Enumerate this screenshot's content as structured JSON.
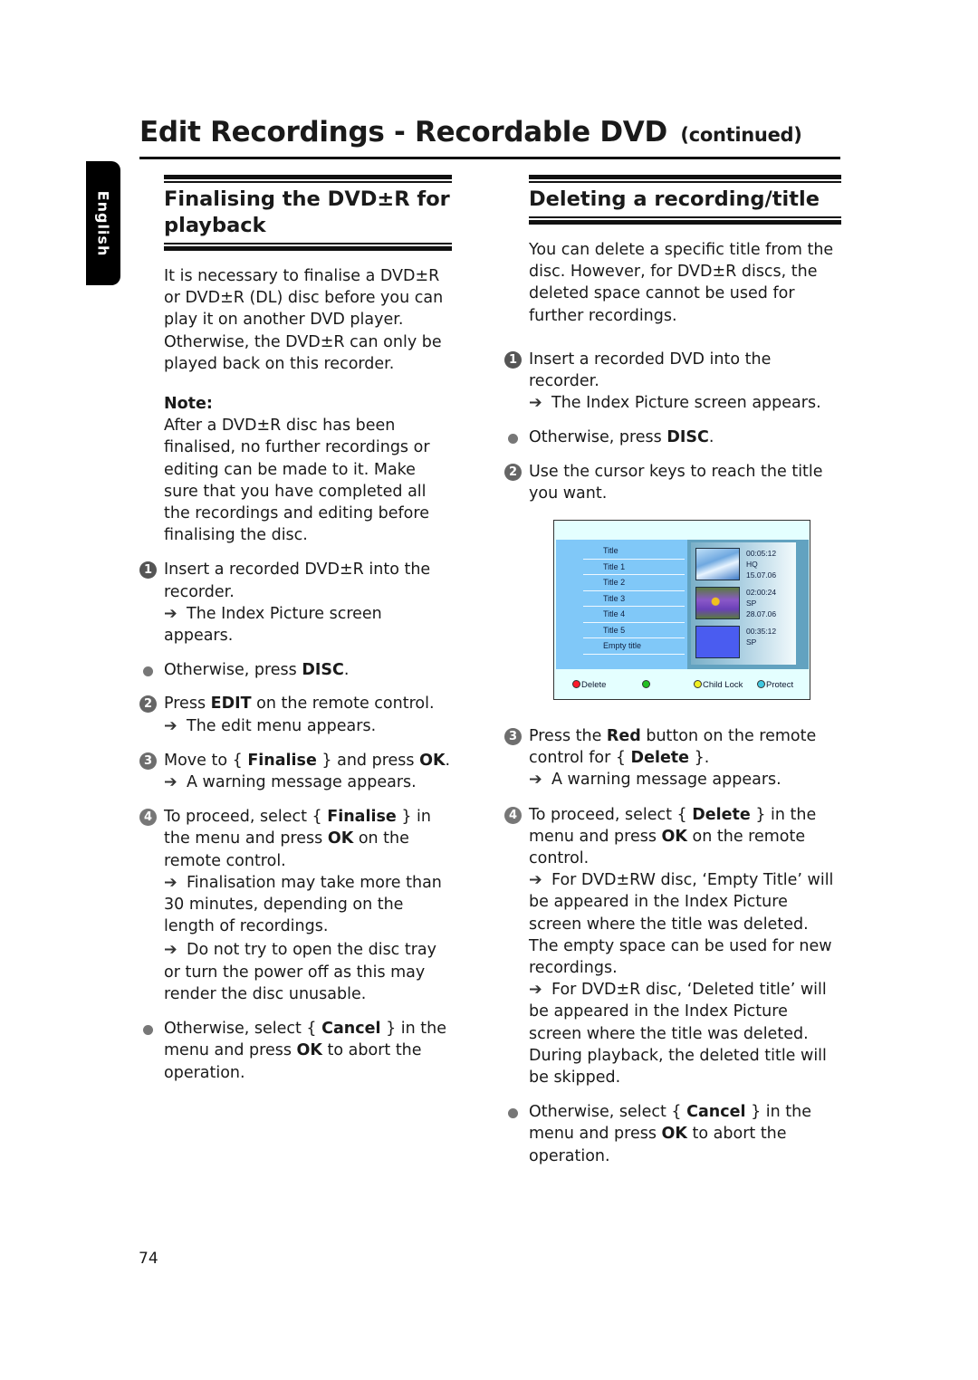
{
  "page": {
    "title": "Edit Recordings - Recordable DVD",
    "title_suffix": "(continued)",
    "language_tab": "English",
    "page_number": "74"
  },
  "left": {
    "heading": "Finalising the DVD±R for playback",
    "intro": "It is necessary to finalise a DVD±R or DVD±R (DL) disc before you can play it on another DVD player. Otherwise, the DVD±R can only be played back on this recorder.",
    "note_label": "Note:",
    "note_text": "After a DVD±R disc has been finalised, no further recordings or editing can be made to it. Make sure that you have completed all the recordings and editing before finalising the disc.",
    "steps": [
      {
        "num": "1",
        "text": "Insert a recorded DVD±R into the recorder.",
        "result": "The Index Picture screen appears."
      },
      {
        "bullet": true,
        "pre": "Otherwise, press ",
        "bold": "DISC",
        "post": "."
      },
      {
        "num": "2",
        "pre": "Press ",
        "bold": "EDIT",
        "post": " on the remote control.",
        "result": "The edit menu appears."
      },
      {
        "num": "3",
        "pre": "Move to { ",
        "bold": "Finalise",
        "mid": " } and press ",
        "bold2": "OK",
        "post": ".",
        "result": "A warning message appears."
      },
      {
        "num": "4",
        "pre": "To proceed, select { ",
        "bold": "Finalise",
        "mid": " } in the menu and press ",
        "bold2": "OK",
        "post": " on the remote control.",
        "result": "Finalisation may take more than 30 minutes, depending on the length of recordings.",
        "result2": "Do not try to open the disc tray or turn the power off as this may render the disc unusable."
      },
      {
        "bullet": true,
        "pre": "Otherwise, select { ",
        "bold": "Cancel",
        "mid": " } in the menu and press ",
        "bold2": "OK",
        "post": " to abort the operation."
      }
    ]
  },
  "right": {
    "heading": "Deleting a recording/title",
    "intro": "You can delete a specific title from the disc. However, for DVD±R discs, the deleted space cannot be used for further recordings.",
    "steps": [
      {
        "num": "1",
        "text": "Insert a recorded DVD into the recorder.",
        "result": "The Index Picture screen appears."
      },
      {
        "bullet": true,
        "pre": "Otherwise, press ",
        "bold": "DISC",
        "post": "."
      },
      {
        "num": "2",
        "text": "Use the cursor keys to reach the title you want."
      },
      {
        "num": "3",
        "pre": "Press the ",
        "bold": "Red",
        "mid": " button on the remote control for { ",
        "bold2": "Delete",
        "post": " }.",
        "result": "A warning message appears."
      },
      {
        "num": "4",
        "pre": "To proceed, select { ",
        "bold": "Delete",
        "mid": " } in the menu and press ",
        "bold2": "OK",
        "post": " on the remote control.",
        "result": "For DVD±RW disc, ‘Empty Title’ will be appeared in the Index Picture screen where the title was deleted. The empty space can be used for new recordings.",
        "result2": "For DVD±R disc, ‘Deleted title’ will be appeared in the Index Picture screen where the title was deleted. During playback, the deleted title will be skipped."
      },
      {
        "bullet": true,
        "pre": "Otherwise, select { ",
        "bold": "Cancel",
        "mid": " } in the menu and press ",
        "bold2": "OK",
        "post": " to abort the operation."
      }
    ]
  },
  "osd": {
    "titles": [
      "Title",
      "Title 1",
      "Title 2",
      "Title 3",
      "Title 4",
      "Title 5",
      "Empty title"
    ],
    "thumbnails": [
      {
        "duration": "00:05:12",
        "mode": "HQ",
        "date": "15.07.06"
      },
      {
        "duration": "02:00:24",
        "mode": "SP",
        "date": "28.07.06"
      },
      {
        "duration": "00:35:12",
        "mode": "SP",
        "date": ""
      }
    ],
    "keys": [
      {
        "color": "#ff1a2a",
        "label": "Delete"
      },
      {
        "color": "#22c022",
        "label": ""
      },
      {
        "color": "#f0f020",
        "label": "Child Lock"
      },
      {
        "color": "#40c8e0",
        "label": "Protect"
      }
    ]
  }
}
